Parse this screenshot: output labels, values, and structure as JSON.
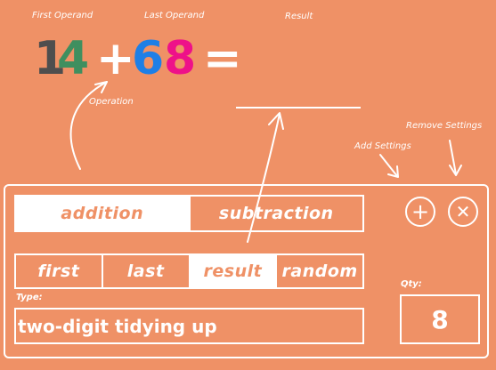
{
  "captions": {
    "first_operand": "First Operand",
    "last_operand": "Last Operand",
    "result": "Result",
    "operation": "Operation",
    "add_settings": "Add Settings",
    "remove_settings": "Remove Settings"
  },
  "equation": {
    "first_digit_1": "1",
    "first_digit_2": "4",
    "operator": "+",
    "last_digit_1": "6",
    "last_digit_2": "8",
    "equals": "=",
    "result_value": ""
  },
  "colors": {
    "background": "#EF9166",
    "first_digit_1": "#4E4E4E",
    "first_digit_2": "#3F8F5F",
    "last_digit_1": "#1E7FE6",
    "last_digit_2": "#EE1189"
  },
  "operation_tabs": {
    "selected": "addition",
    "options": [
      "addition",
      "subtraction"
    ]
  },
  "target_tabs": {
    "selected": "result",
    "options": [
      "first",
      "last",
      "result",
      "random"
    ]
  },
  "type_field": {
    "label": "Type:",
    "value": "two-digit tidying up"
  },
  "qty_field": {
    "label": "Qty:",
    "value": "8"
  },
  "icons": {
    "add": "plus-icon",
    "remove": "close-icon"
  }
}
